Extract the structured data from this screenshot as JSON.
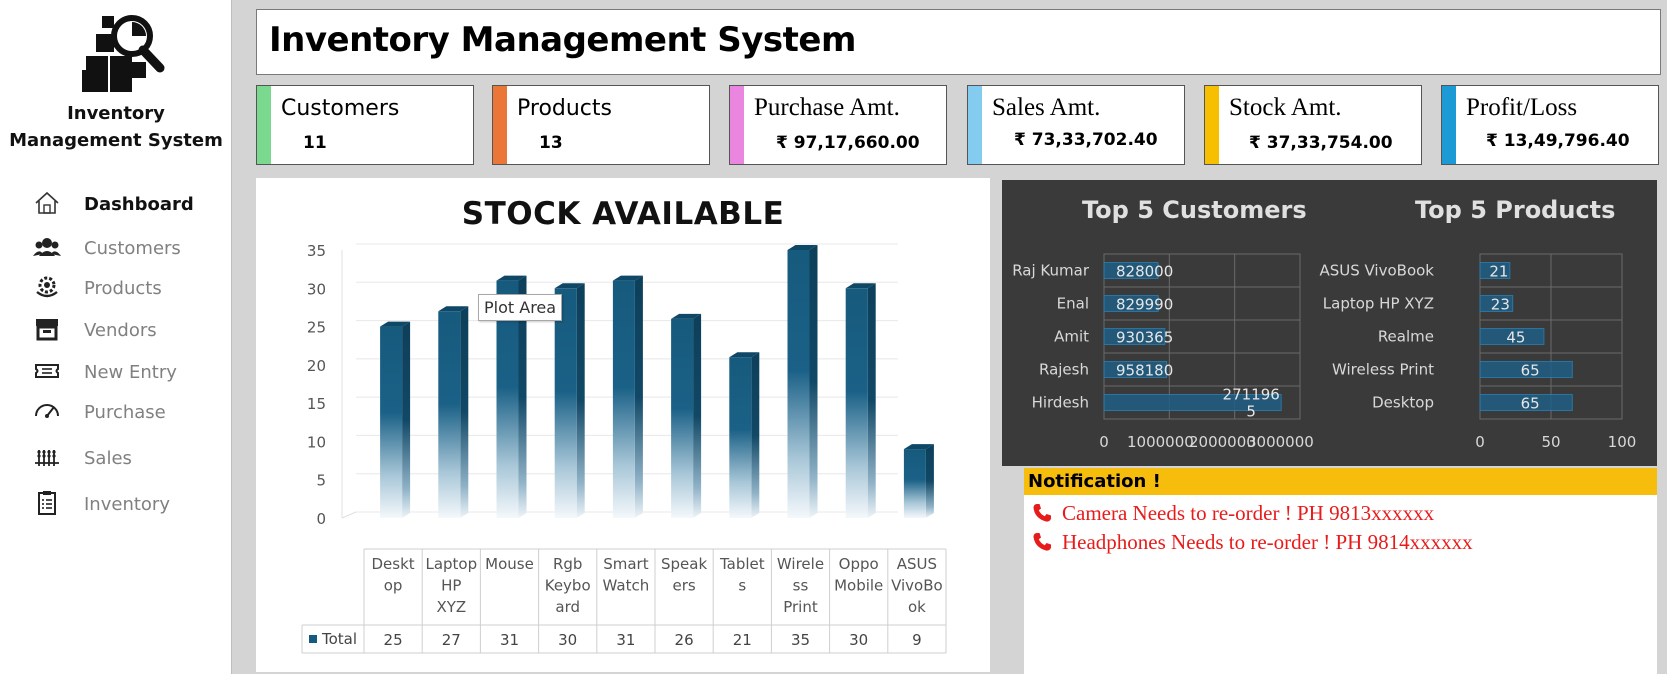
{
  "sidebar": {
    "app_name_line1": "Inventory",
    "app_name_line2": "Management System",
    "items": [
      {
        "label": "Dashboard",
        "icon": "home-icon",
        "active": true
      },
      {
        "label": "Customers",
        "icon": "people-icon"
      },
      {
        "label": "Products",
        "icon": "gear-hand-icon"
      },
      {
        "label": "Vendors",
        "icon": "store-icon"
      },
      {
        "label": "New Entry",
        "icon": "ticket-icon"
      },
      {
        "label": "Purchase",
        "icon": "gauge-icon"
      },
      {
        "label": "Sales",
        "icon": "wheat-icon"
      },
      {
        "label": "Inventory",
        "icon": "clipboard-icon"
      }
    ]
  },
  "header": {
    "title": "Inventory Management System"
  },
  "kpis": [
    {
      "label": "Customers",
      "value": "11",
      "color": "#7bd88f"
    },
    {
      "label": "Products",
      "value": "13",
      "color": "#ea7637"
    },
    {
      "label": "Purchase Amt.",
      "value": "₹ 97,17,660.00",
      "color": "#ea86e0"
    },
    {
      "label": "Sales Amt.",
      "value": "₹ 73,33,702.40",
      "color": "#84cbf0"
    },
    {
      "label": "Stock Amt.",
      "value": "₹ 37,33,754.00",
      "color": "#f6c000"
    },
    {
      "label": "Profit/Loss",
      "value": "₹ 13,49,796.40",
      "color": "#1b9ad6"
    }
  ],
  "stock_chart": {
    "tooltip": "Plot Area",
    "legend_label": "Total"
  },
  "top5": {
    "customers_title": "Top 5 Customers",
    "products_title": "Top 5 Products"
  },
  "notifications": {
    "title": "Notification !",
    "items": [
      "Camera Needs to re-order ! PH 9813xxxxxx",
      "Headphones Needs to re-order ! PH 9814xxxxxx"
    ]
  },
  "chart_data": [
    {
      "type": "bar",
      "title": "STOCK AVAILABLE",
      "categories": [
        "Desktop",
        "Laptop HP XYZ",
        "Mouse",
        "Rgb Keyboard",
        "Smart Watch",
        "Speakers",
        "Tablets",
        "Wireless Print",
        "Oppo Mobile",
        "ASUS VivoBook"
      ],
      "category_lines": [
        [
          "Deskt",
          "op"
        ],
        [
          "Laptop",
          "HP",
          "XYZ"
        ],
        [
          "Mouse"
        ],
        [
          "Rgb",
          "Keybo",
          "ard"
        ],
        [
          "Smart",
          "Watch"
        ],
        [
          "Speak",
          "ers"
        ],
        [
          "Tablet",
          "s"
        ],
        [
          "Wirele",
          "ss",
          "Print"
        ],
        [
          "Oppo",
          "Mobile"
        ],
        [
          "ASUS",
          "VivoBo",
          "ok"
        ]
      ],
      "series": [
        {
          "name": "Total",
          "values": [
            25,
            27,
            31,
            30,
            31,
            26,
            21,
            35,
            30,
            9
          ]
        }
      ],
      "yticks": [
        0,
        5,
        10,
        15,
        20,
        25,
        30,
        35
      ],
      "ylim": [
        0,
        35
      ],
      "grid": true,
      "color": "#165a7d"
    },
    {
      "type": "bar",
      "orientation": "horizontal",
      "title": "Top 5 Customers",
      "categories": [
        "Raj Kumar",
        "Enal",
        "Amit",
        "Rajesh",
        "Hirdesh"
      ],
      "values": [
        828000,
        829990,
        930365,
        958180,
        2711965
      ],
      "value_labels": [
        "828000",
        "829990",
        "930365",
        "958180",
        "271196\n5"
      ],
      "xticks": [
        "0",
        "1000000",
        "2000000",
        "3000000"
      ],
      "xlim": [
        0,
        3000000
      ],
      "color": "#1f5e85"
    },
    {
      "type": "bar",
      "orientation": "horizontal",
      "title": "Top 5 Products",
      "categories": [
        "ASUS VivoBook",
        "Laptop HP XYZ",
        "Realme",
        "Wireless Print",
        "Desktop"
      ],
      "values": [
        21,
        23,
        45,
        65,
        65
      ],
      "xticks": [
        "0",
        "50",
        "100"
      ],
      "xlim": [
        0,
        100
      ],
      "color": "#1f5e85"
    }
  ]
}
